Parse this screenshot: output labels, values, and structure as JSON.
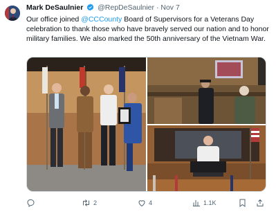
{
  "post": {
    "author_name": "Mark DeSaulnier",
    "handle": "@RepDeSaulnier",
    "separator": "·",
    "date": "Nov 7",
    "text_before_mention": "Our office joined ",
    "mention": "@CCCounty",
    "text_after_mention": " Board of Supervisors for a Veterans Day celebration to thank those who have bravely served our nation and to honor military families. We also marked the 50th anniversary of the Vietnam War."
  },
  "actions": {
    "replies": "",
    "reposts": "2",
    "likes": "4",
    "views": "1.1K"
  },
  "icons": {
    "verified": "verified-badge-icon",
    "reply": "reply-icon",
    "repost": "repost-icon",
    "like": "heart-icon",
    "views": "views-icon",
    "bookmark": "bookmark-icon",
    "share": "share-icon"
  },
  "colors": {
    "accent": "#1d9bf0",
    "muted": "#536471"
  }
}
